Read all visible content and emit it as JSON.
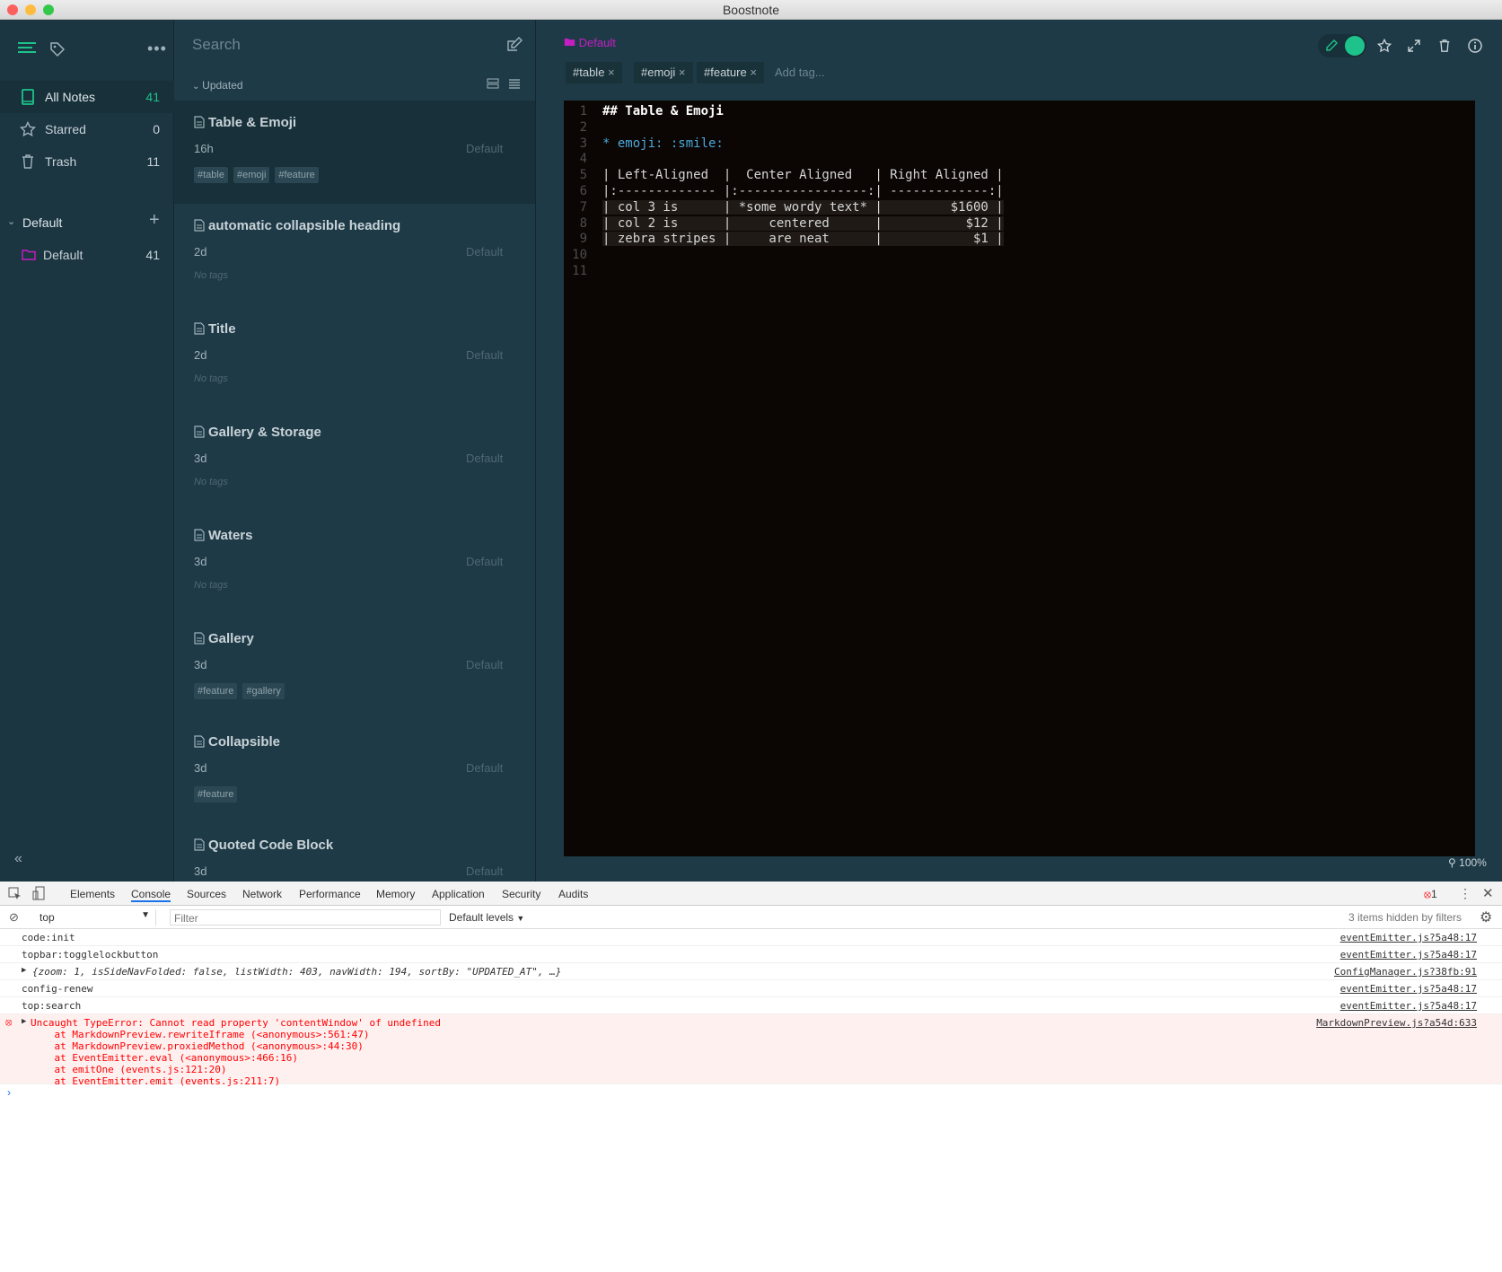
{
  "window": {
    "title": "Boostnote"
  },
  "sidenav": {
    "items": [
      {
        "label": "All Notes",
        "count": "41"
      },
      {
        "label": "Starred",
        "count": "0"
      },
      {
        "label": "Trash",
        "count": "11"
      }
    ],
    "storage": {
      "label": "Default"
    },
    "folders": [
      {
        "label": "Default",
        "count": "41"
      }
    ]
  },
  "notelist": {
    "search_placeholder": "Search",
    "sort_label": "Updated",
    "notes": [
      {
        "title": "Table & Emoji",
        "time": "16h",
        "folder": "Default",
        "tags": [
          "#table",
          "#emoji",
          "#feature"
        ]
      },
      {
        "title": "automatic collapsible heading",
        "time": "2d",
        "folder": "Default",
        "tags": []
      },
      {
        "title": "Title",
        "time": "2d",
        "folder": "Default",
        "tags": []
      },
      {
        "title": "Gallery & Storage",
        "time": "3d",
        "folder": "Default",
        "tags": []
      },
      {
        "title": "Waters",
        "time": "3d",
        "folder": "Default",
        "tags": []
      },
      {
        "title": "Gallery",
        "time": "3d",
        "folder": "Default",
        "tags": [
          "#feature",
          "#gallery"
        ]
      },
      {
        "title": "Collapsible",
        "time": "3d",
        "folder": "Default",
        "tags": [
          "#feature"
        ]
      },
      {
        "title": "Quoted Code Block",
        "time": "3d",
        "folder": "Default",
        "tags": []
      }
    ],
    "no_tags_label": "No tags"
  },
  "detail": {
    "folder": "Default",
    "tags": [
      "#table",
      "#emoji",
      "#feature"
    ],
    "add_tag_placeholder": "Add tag...",
    "zoom": "100%",
    "lines": [
      "## Table & Emoji",
      "",
      "* emoji: :smile:",
      "",
      "| Left-Aligned  |  Center Aligned   | Right Aligned |",
      "|:------------- |:-----------------:| -------------:|",
      "| col 3 is      | *some wordy text* |         $1600 |",
      "| col 2 is      |     centered      |           $12 |",
      "| zebra stripes |     are neat      |            $1 |",
      "",
      ""
    ]
  },
  "devtools": {
    "tabs": [
      "Elements",
      "Console",
      "Sources",
      "Network",
      "Performance",
      "Memory",
      "Application",
      "Security",
      "Audits"
    ],
    "error_count": "1",
    "context": "top",
    "filter_placeholder": "Filter",
    "levels": "Default levels",
    "hidden_note": "3 items hidden by filters",
    "logs": [
      {
        "msg": "code:init",
        "src": "eventEmitter.js?5a48:17"
      },
      {
        "msg": "topbar:togglelockbutton",
        "src": "eventEmitter.js?5a48:17"
      },
      {
        "msg": "{zoom: 1, isSideNavFolded: false, listWidth: 403, navWidth: 194, sortBy: \"UPDATED_AT\", …}",
        "src": "ConfigManager.js?38fb:91"
      },
      {
        "msg": "config-renew",
        "src": "eventEmitter.js?5a48:17"
      },
      {
        "msg": "top:search",
        "src": "eventEmitter.js?5a48:17"
      }
    ],
    "error": {
      "msg": "Uncaught TypeError: Cannot read property 'contentWindow' of undefined\n    at MarkdownPreview.rewriteIframe (<anonymous>:561:47)\n    at MarkdownPreview.proxiedMethod (<anonymous>:44:30)\n    at EventEmitter.eval (<anonymous>:466:16)\n    at emitOne (events.js:121:20)\n    at EventEmitter.emit (events.js:211:7)",
      "src": "MarkdownPreview.js?a54d:633"
    }
  },
  "colors": {
    "accent": "#1ec38b",
    "folder": "#c51ec3",
    "bg": "#1e3a47",
    "editor_bg": "#0b0503"
  }
}
